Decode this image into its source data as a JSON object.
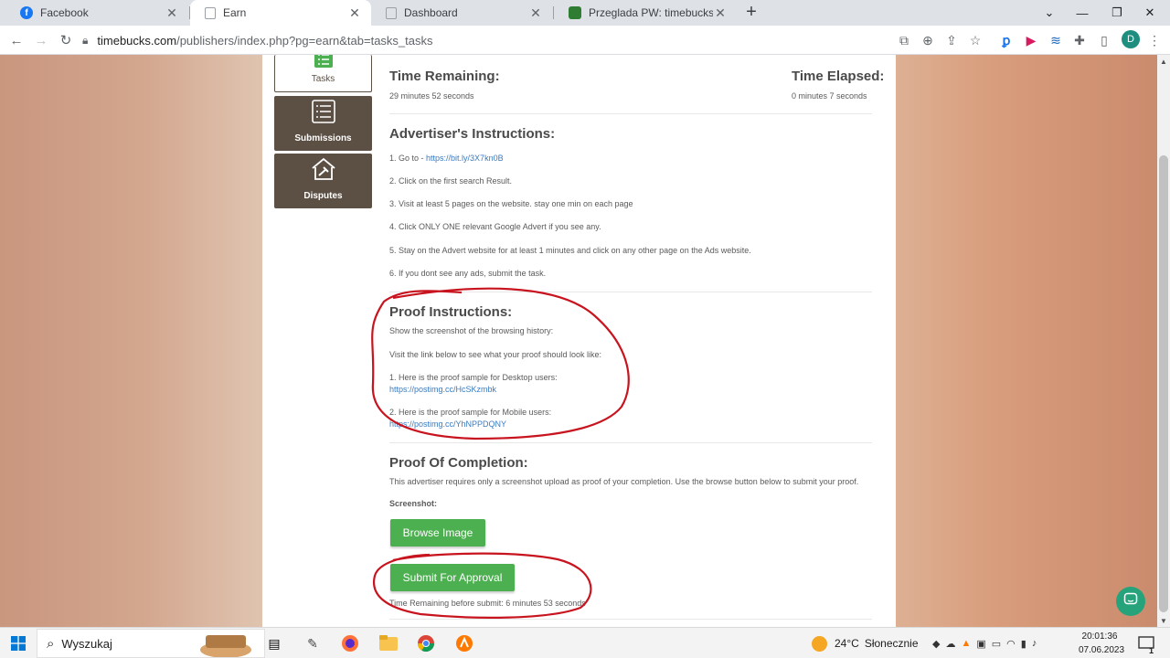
{
  "browser": {
    "tabs": [
      {
        "title": "Facebook",
        "active": false
      },
      {
        "title": "Earn",
        "active": true
      },
      {
        "title": "Dashboard",
        "active": false
      },
      {
        "title": "Przeglada PW: timebucks",
        "active": false
      }
    ],
    "url_host": "timebucks.com",
    "url_path": "/publishers/index.php?pg=earn&tab=tasks_tasks",
    "profile_initial": "D"
  },
  "sidebar": {
    "tasks_label": "Tasks",
    "submissions_label": "Submissions",
    "disputes_label": "Disputes"
  },
  "task": {
    "time_remaining_label": "Time Remaining:",
    "time_remaining_value": "29 minutes 52 seconds",
    "time_elapsed_label": "Time Elapsed:",
    "time_elapsed_value": "0 minutes 7 seconds",
    "advertiser_heading": "Advertiser's Instructions:",
    "step1_prefix": "1. Go to - ",
    "step1_link": "https://bit.ly/3X7kn0B",
    "step2": "2. Click on the first search Result.",
    "step3": "3. Visit at least 5 pages on the website. stay one min on each page",
    "step4": "4. Click ONLY ONE relevant Google Advert if you see any.",
    "step5": "5. Stay on the Advert website for at least 1 minutes and click on any other page on the Ads website.",
    "step6": "6. If you dont see any ads, submit the task.",
    "proof_heading": "Proof Instructions:",
    "proof_line1": "Show the screenshot of the browsing history:",
    "proof_line2": "Visit the link below to see what your proof should look like:",
    "proof_desktop": "1. Here is the proof sample for Desktop users:",
    "proof_desktop_link": "https://postimg.cc/HcSKzmbk",
    "proof_mobile": "2. Here is the proof sample for Mobile users:",
    "proof_mobile_link": "https://postimg.cc/YhNPPDQNY",
    "completion_heading": "Proof Of Completion:",
    "completion_text": "This advertiser requires only a screenshot upload as proof of your completion. Use the browse button below to submit your proof.",
    "screenshot_label": "Screenshot:",
    "browse_button": "Browse Image",
    "submit_button": "Submit For Approval",
    "submit_timer": "Time Remaining before submit: 6 minutes 53 seconds"
  },
  "taskbar": {
    "search_placeholder": "Wyszukaj",
    "weather_temp": "24°C",
    "weather_text": "Słonecznie",
    "time": "20:01:36",
    "date": "07.06.2023",
    "notification_count": "1"
  },
  "colors": {
    "accent_green": "#4caf50",
    "tile_brown": "#5c4f43",
    "annotation_red": "#c8141e",
    "link_blue": "#3b7bbf"
  }
}
